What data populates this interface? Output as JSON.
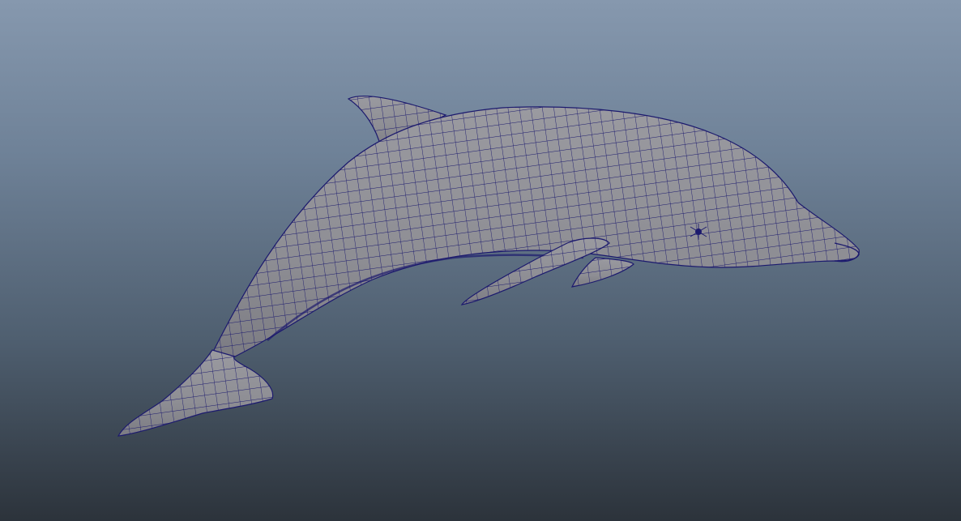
{
  "viewport": {
    "background_top": "#8698ae",
    "background_bottom": "#2c333b"
  },
  "model": {
    "subject": "dolphin-icon",
    "shading": "gray-smooth-with-wireframe",
    "surface_color": "#8e8e94",
    "wireframe_color": "#1c1a6e"
  }
}
